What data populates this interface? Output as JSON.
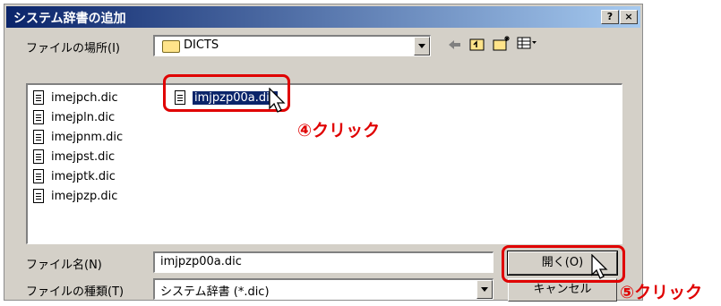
{
  "window": {
    "title": "システム辞書の追加",
    "help_btn": "?",
    "close_btn": "×"
  },
  "location": {
    "label": "ファイルの場所(I)",
    "value": "DICTS"
  },
  "toolbar": {
    "icons": [
      "back-icon",
      "up-folder-icon",
      "new-folder-icon",
      "view-menu-icon"
    ]
  },
  "files": [
    {
      "name": "imejpch.dic"
    },
    {
      "name": "imejpln.dic"
    },
    {
      "name": "imejpnm.dic"
    },
    {
      "name": "imejpst.dic"
    },
    {
      "name": "imejptk.dic"
    },
    {
      "name": "imejpzp.dic"
    },
    {
      "name": "imjpzp00a.dic",
      "selected": true
    }
  ],
  "filename": {
    "label": "ファイル名(N)",
    "value": "imjpzp00a.dic"
  },
  "filetype": {
    "label": "ファイルの種類(T)",
    "value": "システム辞書 (*.dic)"
  },
  "buttons": {
    "open": "開く(O)",
    "cancel": "キャンセル"
  },
  "annotations": {
    "step4": "④クリック",
    "step5": "⑤クリック",
    "color": "#e00000"
  }
}
